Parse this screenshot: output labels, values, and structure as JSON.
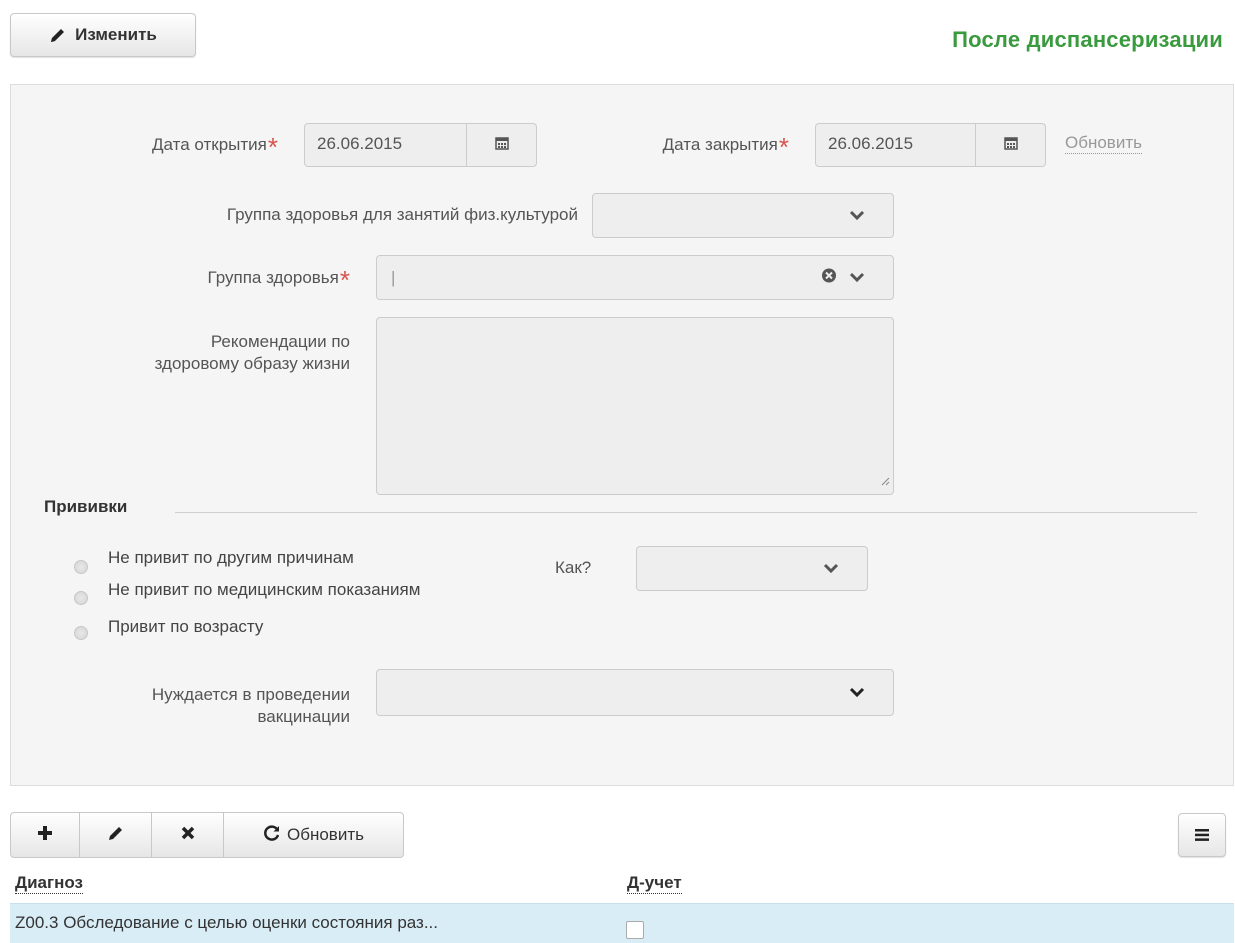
{
  "header": {
    "edit_label": "Изменить",
    "title": "После диспансеризации"
  },
  "form": {
    "open_date_label": "Дата открытия",
    "open_date_value": "26.06.2015",
    "close_date_label": "Дата закрытия",
    "close_date_value": "26.06.2015",
    "refresh_link": "Обновить",
    "pe_group_label": "Группа здоровья для занятий физ.культурой",
    "pe_group_value": "",
    "health_group_label": "Группа здоровья",
    "health_group_value": "|",
    "recommend_label_1": "Рекомендации по",
    "recommend_label_2": "здоровому образу жизни",
    "recommend_value": ""
  },
  "vaccinations": {
    "legend": "Прививки",
    "options": [
      "Не привит по другим причинам",
      "Не привит по медицинским показаниям",
      "Привит по возрасту"
    ],
    "how_label": "Как?",
    "how_value": "",
    "needs_label_1": "Нуждается в проведении",
    "needs_label_2": "вакцинации",
    "needs_value": ""
  },
  "toolbar": {
    "refresh_label": "Обновить"
  },
  "table": {
    "columns": [
      "Диагноз",
      "Д-учет"
    ],
    "rows": [
      {
        "diagnosis": "Z00.3 Обследование с целью оценки состояния раз...",
        "d_account": false
      }
    ]
  },
  "colors": {
    "title_green": "#3a9a3e",
    "required_red": "#d9534f",
    "selected_row": "#d9edf7"
  }
}
